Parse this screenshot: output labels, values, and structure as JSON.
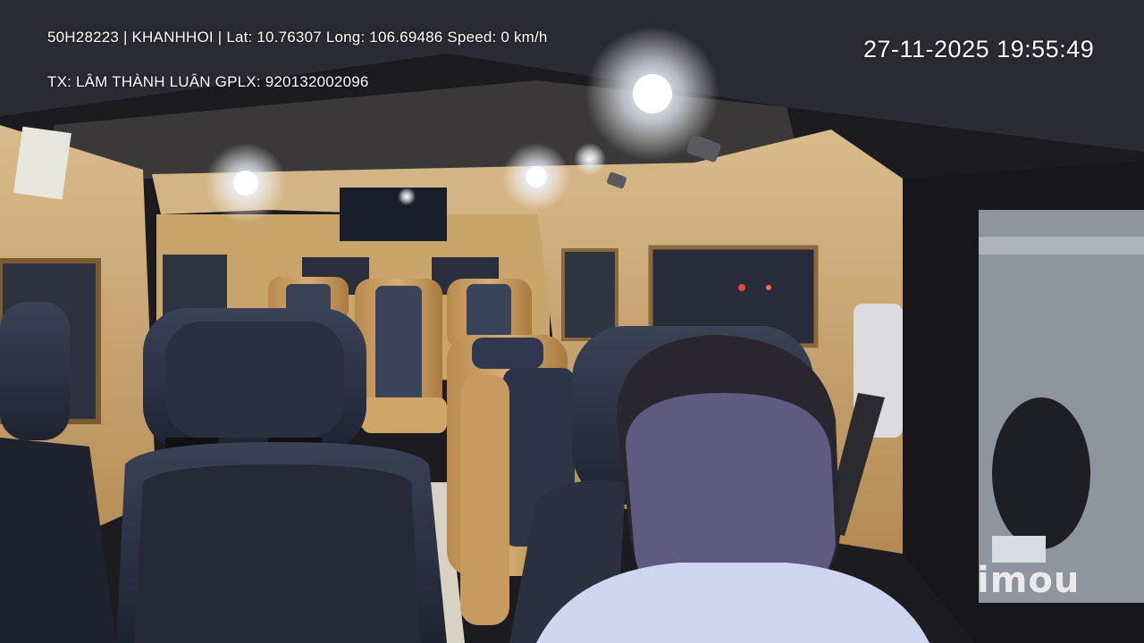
{
  "overlay": {
    "line1": "50H28223 | KHANHHOI | Lat: 10.76307 Long: 106.69486 Speed: 0 km/h",
    "line2": "TX: LÂM THÀNH LUÂN GPLX: 920132002096",
    "timestamp": "27-11-2025 19:55:49"
  },
  "watermark": {
    "text": "imou"
  },
  "colors": {
    "cabin_tan": "#c9a46b",
    "ceiling": "#d8b888",
    "seat_blue": "#2b3448",
    "dark": "#141418",
    "light": "#ffffff"
  }
}
